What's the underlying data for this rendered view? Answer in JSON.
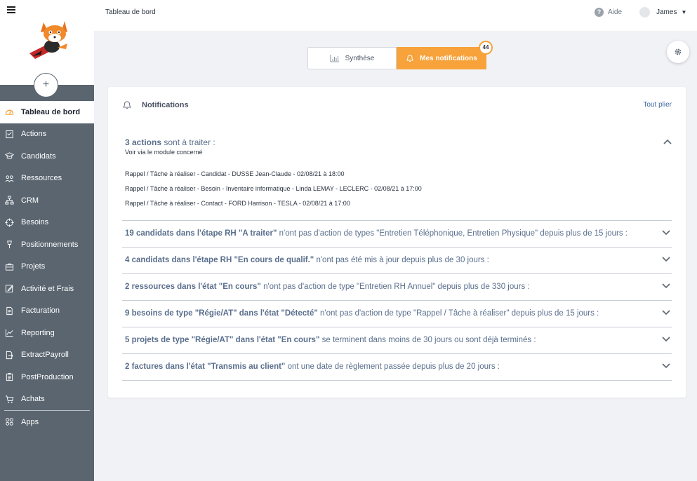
{
  "header": {
    "title": "Tableau de bord",
    "help_label": "Aide",
    "user_name": "James"
  },
  "sidebar": {
    "add_label": "+",
    "items": [
      {
        "label": "Tableau de bord",
        "icon": "gauge-icon"
      },
      {
        "label": "Actions",
        "icon": "checklist-icon"
      },
      {
        "label": "Candidats",
        "icon": "graduation-cap-icon"
      },
      {
        "label": "Ressources",
        "icon": "people-icon"
      },
      {
        "label": "CRM",
        "icon": "hierarchy-icon"
      },
      {
        "label": "Besoins",
        "icon": "target-icon"
      },
      {
        "label": "Positionnements",
        "icon": "pin-icon"
      },
      {
        "label": "Projets",
        "icon": "briefcase-icon"
      },
      {
        "label": "Activité et Frais",
        "icon": "edit-icon"
      },
      {
        "label": "Facturation",
        "icon": "invoice-icon"
      },
      {
        "label": "Reporting",
        "icon": "chart-line-icon"
      },
      {
        "label": "ExtractPayroll",
        "icon": "document-export-icon"
      },
      {
        "label": "PostProduction",
        "icon": "clipboard-icon"
      },
      {
        "label": "Achats",
        "icon": "cart-icon"
      },
      {
        "label": "Apps",
        "icon": "apps-icon"
      }
    ]
  },
  "toggle": {
    "synthese": "Synthèse",
    "notifications": "Mes notifications",
    "badge": "44"
  },
  "card": {
    "title": "Notifications",
    "collapse_all": "Tout plier",
    "first": {
      "bold": "3 actions",
      "rest": " sont à traiter  :",
      "sub": "Voir via le module concerné",
      "rows": [
        "Rappel / Tâche à réaliser - Candidat - DUSSE Jean-Claude - 02/08/21 à 18:00",
        "Rappel / Tâche à réaliser - Besoin - Inventaire informatique - Linda LEMAY - LECLERC - 02/08/21 à 17:00",
        "Rappel / Tâche à réaliser - Contact - FORD Harrison - TESLA - 02/08/21 à 17:00"
      ]
    },
    "sections": [
      {
        "bold": "19 candidats dans l'étape RH \"A traiter\"",
        "rest": " n'ont pas d'action de types \"Entretien Téléphonique, Entretien Physique\" depuis plus de 15 jours  :"
      },
      {
        "bold": "4 candidats dans l'étape RH \"En cours de qualif.\"",
        "rest": " n'ont pas été mis à jour depuis plus de 30 jours  :"
      },
      {
        "bold": "2 ressources dans l'état \"En cours\"",
        "rest": " n'ont pas d'action de type \"Entretien RH Annuel\" depuis plus de 330 jours  :"
      },
      {
        "bold": "9 besoins de type \"Régie/AT\" dans l'état \"Détecté\"",
        "rest": " n'ont pas d'action de type \"Rappel / Tâche à réaliser\" depuis plus de 15 jours  :"
      },
      {
        "bold": "5 projets de type \"Régie/AT\" dans l'état \"En cours\"",
        "rest": " se terminent dans moins de 30 jours ou sont déjà terminés :"
      },
      {
        "bold": "2 factures dans l'état \"Transmis au client\"",
        "rest": " ont une date de règlement passée depuis plus de 20 jours  :"
      }
    ]
  },
  "colors": {
    "accent": "#f7a23a",
    "sidebar": "#5a6570",
    "link": "#3f6aa0"
  }
}
